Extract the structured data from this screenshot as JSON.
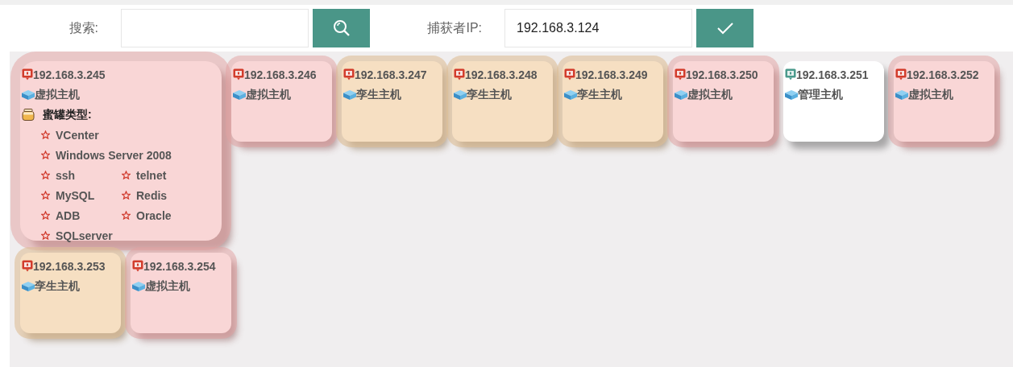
{
  "search": {
    "label": "搜索:"
  },
  "capturer": {
    "label": "捕获者IP:",
    "value": "192.168.3.124"
  },
  "hosts": [
    {
      "ip": "192.168.3.245",
      "type": "虚拟主机",
      "kind": "virtual",
      "honeypot": {
        "label": "蜜罐类型:",
        "types": [
          "VCenter",
          "Windows Server 2008",
          "ssh",
          "telnet",
          "MySQL",
          "Redis",
          "ADB",
          "Oracle",
          "SQLserver"
        ]
      }
    },
    {
      "ip": "192.168.3.246",
      "type": "虚拟主机",
      "kind": "virtual"
    },
    {
      "ip": "192.168.3.247",
      "type": "孪生主机",
      "kind": "twin"
    },
    {
      "ip": "192.168.3.248",
      "type": "孪生主机",
      "kind": "twin"
    },
    {
      "ip": "192.168.3.249",
      "type": "孪生主机",
      "kind": "twin"
    },
    {
      "ip": "192.168.3.250",
      "type": "虚拟主机",
      "kind": "virtual"
    },
    {
      "ip": "192.168.3.251",
      "type": "管理主机",
      "kind": "manager"
    },
    {
      "ip": "192.168.3.252",
      "type": "虚拟主机",
      "kind": "virtual"
    },
    {
      "ip": "192.168.3.253",
      "type": "孪生主机",
      "kind": "twin"
    },
    {
      "ip": "192.168.3.254",
      "type": "虚拟主机",
      "kind": "virtual"
    }
  ]
}
